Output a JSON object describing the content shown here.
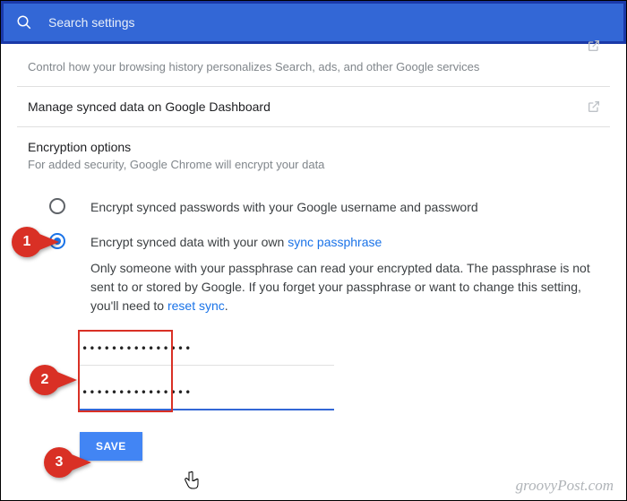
{
  "search": {
    "placeholder": "Search settings"
  },
  "rows": {
    "history": {
      "subtitle": "Control how your browsing history personalizes Search, ads, and other Google services"
    },
    "dashboard": {
      "title": "Manage synced data on Google Dashboard"
    },
    "encryption": {
      "title": "Encryption options",
      "subtitle": "For added security, Google Chrome will encrypt your data"
    }
  },
  "options": {
    "opt1": {
      "label": "Encrypt synced passwords with your Google username and password"
    },
    "opt2": {
      "label_prefix": "Encrypt synced data with your own ",
      "link_text": "sync passphrase",
      "desc_part1": "Only someone with your passphrase can read your encrypted data. The passphrase is not sent to or stored by Google. If you forget your passphrase or want to change this setting, you'll need to ",
      "reset_link": "reset sync",
      "desc_part2": "."
    }
  },
  "inputs": {
    "pw1": "•••••••••••••••",
    "pw2": "•••••••••••••••"
  },
  "buttons": {
    "save": "SAVE"
  },
  "callouts": {
    "c1": "1",
    "c2": "2",
    "c3": "3"
  },
  "watermark": "groovyPost.com"
}
